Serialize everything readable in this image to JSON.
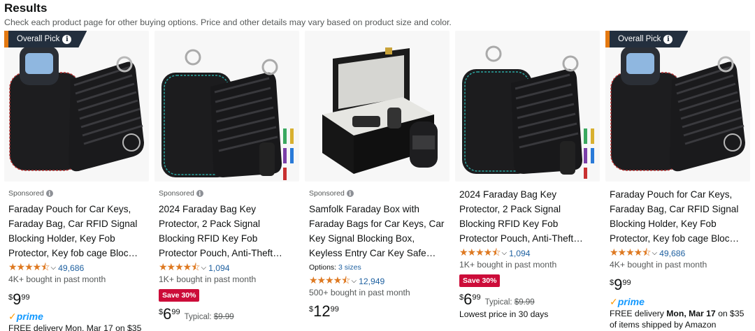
{
  "header": {
    "title": "Results",
    "subtitle": "Check each product page for other buying options. Price and other details may vary based on product size and color."
  },
  "colors": {
    "star": "#de7921",
    "link": "#2162a1",
    "save_badge": "#cc0c39",
    "overall_pick_bg": "#232f3e",
    "overall_pick_accent": "#e47911",
    "prime": "#1399ff"
  },
  "products": [
    {
      "badge": "Overall Pick",
      "sponsored": "Sponsored",
      "title": "Faraday Pouch for Car Keys, Faraday Bag, Car RFID Signal Blocking Holder, Key Fob Protector, Key fob cage Bloc…",
      "stars": "★★★★⯪",
      "rating": 4.5,
      "reviews": "49,686",
      "bought": "4K+ bought in past month",
      "price_symbol": "$",
      "price_whole": "9",
      "price_fraction": "99",
      "prime_label": "prime",
      "delivery": "FREE delivery Mon, Mar 17 on $35"
    },
    {
      "sponsored": "Sponsored",
      "title": "2024 Faraday Bag Key Protector, 2 Pack Signal Blocking RFID Key Fob Protector Pouch, Anti-Theft…",
      "stars": "★★★★⯪",
      "rating": 4.5,
      "reviews": "1,094",
      "bought": "1K+ bought in past month",
      "save": "Save 30%",
      "price_symbol": "$",
      "price_whole": "6",
      "price_fraction": "99",
      "typical_label": "Typical:",
      "typical_price": "$9.99"
    },
    {
      "sponsored": "Sponsored",
      "title": "Samfolk Faraday Box with Faraday Bags for Car Keys, Car Key Signal Blocking Box, Keyless Entry Car Key Safe…",
      "options_label": "Options:",
      "options_value": "3 sizes",
      "stars": "★★★★⯪",
      "rating": 4.5,
      "reviews": "12,949",
      "bought": "500+ bought in past month",
      "price_symbol": "$",
      "price_whole": "12",
      "price_fraction": "99"
    },
    {
      "title": "2024 Faraday Bag Key Protector, 2 Pack Signal Blocking RFID Key Fob Protector Pouch, Anti-Theft…",
      "stars": "★★★★⯪",
      "rating": 4.5,
      "reviews": "1,094",
      "bought": "1K+ bought in past month",
      "save": "Save 30%",
      "price_symbol": "$",
      "price_whole": "6",
      "price_fraction": "99",
      "typical_label": "Typical:",
      "typical_price": "$9.99",
      "lowest": "Lowest price in 30 days"
    },
    {
      "badge": "Overall Pick",
      "title": "Faraday Pouch for Car Keys, Faraday Bag, Car RFID Signal Blocking Holder, Key Fob Protector, Key fob cage Bloc…",
      "stars": "★★★★⯪",
      "rating": 4.5,
      "reviews": "49,686",
      "bought": "4K+ bought in past month",
      "price_symbol": "$",
      "price_whole": "9",
      "price_fraction": "99",
      "prime_label": "prime",
      "delivery_prefix": "FREE delivery",
      "delivery_date": "Mon, Mar 17",
      "delivery_suffix": "on $35",
      "delivery_line2": "of items shipped by Amazon"
    }
  ]
}
